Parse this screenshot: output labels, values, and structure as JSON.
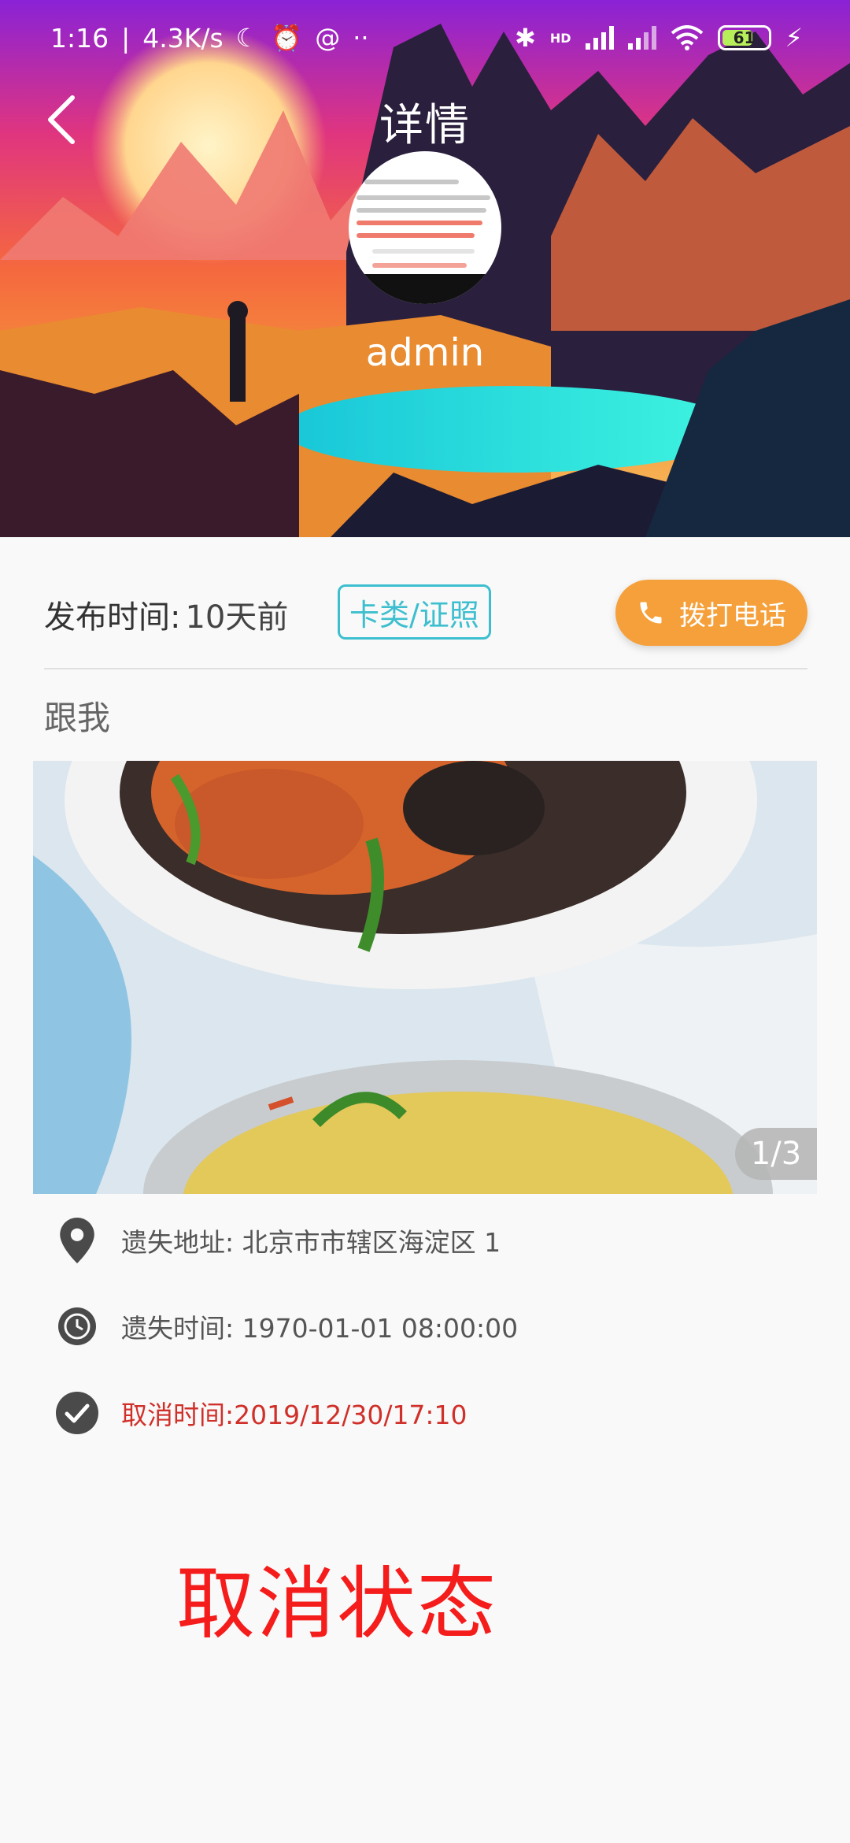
{
  "status_bar": {
    "time": "1:16",
    "speed": "4.3K/s",
    "network": "HD",
    "battery": "61"
  },
  "header": {
    "title": "详情",
    "username": "admin"
  },
  "info": {
    "publish_label": "发布时间:",
    "publish_value": "10天前",
    "category": "卡类/证照",
    "call_label": "拨打电话"
  },
  "post": {
    "title": "跟我",
    "photo_counter": "1/3"
  },
  "details": {
    "lost_address": "遗失地址: 北京市市辖区海淀区 1",
    "lost_time": "遗失时间: 1970-01-01 08:00:00",
    "cancel_time": "取消时间:2019/12/30/17:10"
  },
  "status": {
    "label": "取消状态"
  },
  "colors": {
    "accent_orange": "#f5a03a",
    "tag_cyan": "#3dbfcf",
    "cancel_red": "#f51c1c"
  }
}
